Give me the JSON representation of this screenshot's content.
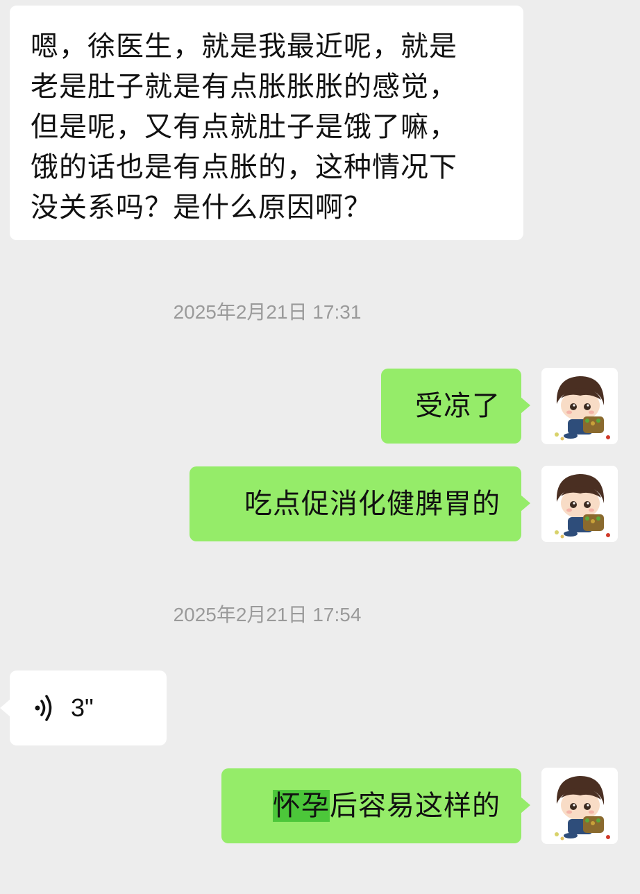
{
  "messages": [
    {
      "kind": "text",
      "side": "incoming",
      "lines": [
        "嗯，徐医生，就是我最近呢，就是",
        "老是肚子就是有点胀胀胀的感觉，",
        "但是呢，又有点就肚子是饿了嘛，",
        "饿的话也是有点胀的，这种情况下",
        "没关系吗？是什么原因啊？"
      ]
    },
    {
      "kind": "timestamp",
      "text": "2025年2月21日 17:31"
    },
    {
      "kind": "text",
      "side": "outgoing",
      "text": "受凉了"
    },
    {
      "kind": "text",
      "side": "outgoing",
      "text": "吃点促消化健脾胃的"
    },
    {
      "kind": "timestamp",
      "text": "2025年2月21日 17:54"
    },
    {
      "kind": "voice",
      "side": "incoming",
      "duration": "3\"",
      "icon": "voice-wave-icon"
    },
    {
      "kind": "text",
      "side": "outgoing",
      "highlighted": "怀孕",
      "rest": "后容易这样的"
    }
  ],
  "avatar": {
    "icon": "cartoon-boy-avatar"
  },
  "colors": {
    "background": "#ededed",
    "incoming_bubble": "#ffffff",
    "outgoing_bubble": "#95ec69",
    "selection_highlight": "#4cc73a",
    "timestamp_text": "#9a9a9a"
  }
}
